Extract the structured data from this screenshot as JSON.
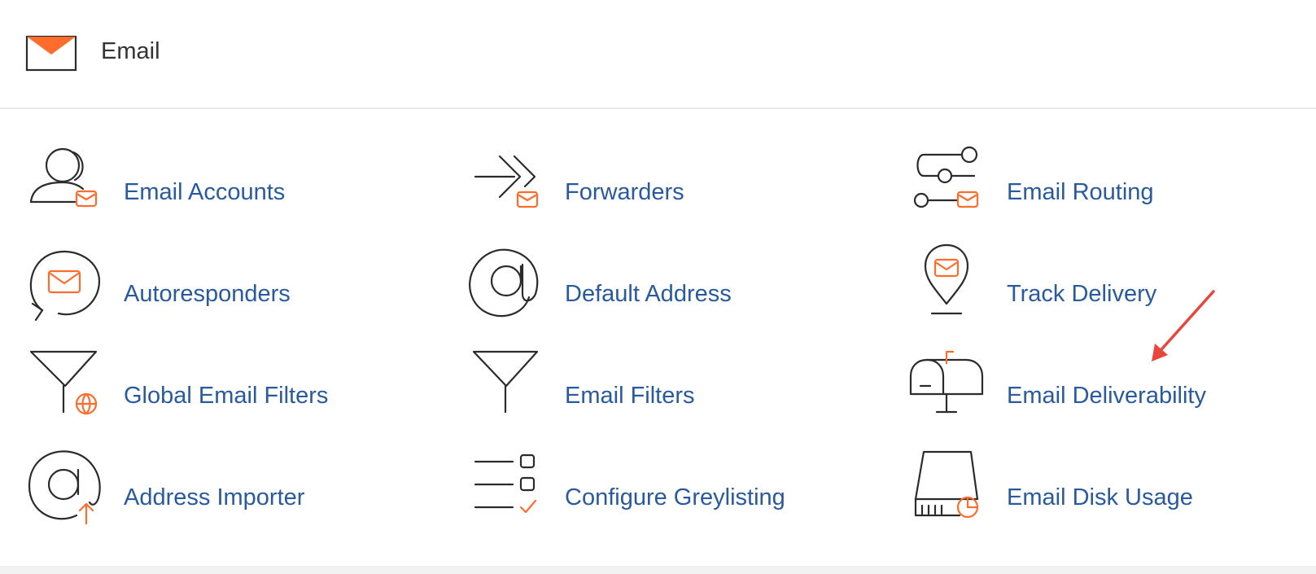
{
  "section": {
    "title": "Email",
    "icon": "envelope-icon"
  },
  "colors": {
    "link": "#295a9e",
    "accent": "#ff6c2c",
    "icon_stroke": "#2b2b2b",
    "annotation_arrow": "#e8453c"
  },
  "items": [
    {
      "label": "Email Accounts",
      "icon": "email-accounts-icon"
    },
    {
      "label": "Forwarders",
      "icon": "forwarders-icon"
    },
    {
      "label": "Email Routing",
      "icon": "email-routing-icon"
    },
    {
      "label": "Autoresponders",
      "icon": "autoresponders-icon"
    },
    {
      "label": "Default Address",
      "icon": "default-address-icon"
    },
    {
      "label": "Track Delivery",
      "icon": "track-delivery-icon"
    },
    {
      "label": "Global Email Filters",
      "icon": "global-email-filters-icon"
    },
    {
      "label": "Email Filters",
      "icon": "email-filters-icon"
    },
    {
      "label": "Email Deliverability",
      "icon": "email-deliverability-icon"
    },
    {
      "label": "Address Importer",
      "icon": "address-importer-icon"
    },
    {
      "label": "Configure Greylisting",
      "icon": "configure-greylisting-icon"
    },
    {
      "label": "Email Disk Usage",
      "icon": "email-disk-usage-icon"
    }
  ]
}
